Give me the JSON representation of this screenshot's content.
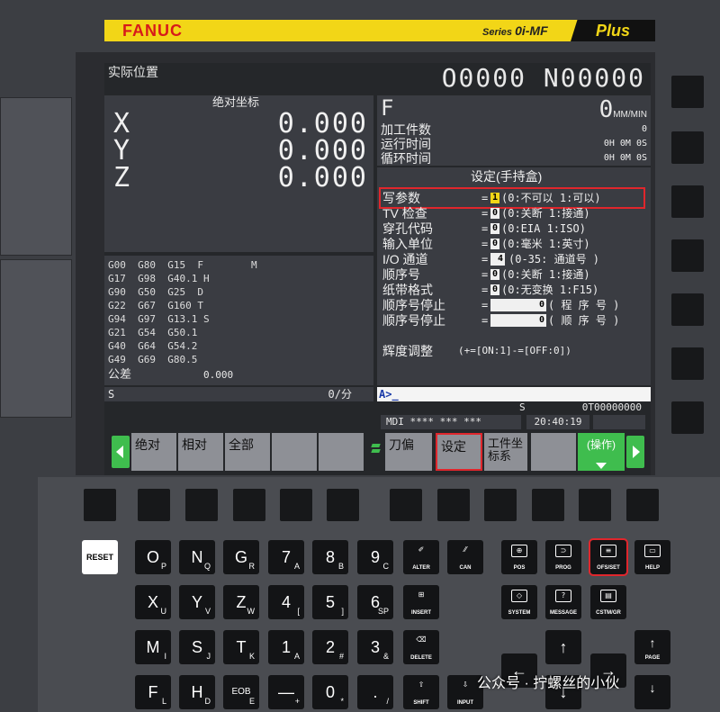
{
  "brand": {
    "name": "FANUC",
    "series": "Series",
    "model": "0i-MF",
    "plus": "Plus"
  },
  "screen": {
    "title": "实际位置",
    "program": "O0000 N00000",
    "abs_title": "绝对坐标",
    "axes": [
      {
        "name": "X",
        "value": "0.000"
      },
      {
        "name": "Y",
        "value": "0.000"
      },
      {
        "name": "Z",
        "value": "0.000"
      }
    ],
    "feed_label": "F",
    "feed_value": "0",
    "feed_unit": "MM/MIN",
    "counters": [
      {
        "label": "加工件数",
        "value": "0"
      },
      {
        "label": "运行时间",
        "value": "0H 0M 0S"
      },
      {
        "label": "循环时间",
        "value": "0H 0M 0S"
      }
    ],
    "gcodes": [
      "G00  G80  G15  F        M",
      "G17  G98  G40.1 H",
      "G90  G50  G25  D",
      "G22  G67  G160 T",
      "G94  G97  G13.1 S",
      "G21  G54  G50.1",
      "G40  G64  G54.2",
      "G49  G69  G80.5"
    ],
    "tolerance_label": "公差",
    "tolerance_value": "0.000",
    "spindle_label": "S",
    "spindle_unit": "0/分",
    "settings_title": "设定(手持盒)",
    "settings": [
      {
        "label": "写参数",
        "value": "1",
        "desc": "(0:不可以    1:可以)"
      },
      {
        "label": "TV  检查",
        "value": "0",
        "desc": "(0:关断 1:接通)"
      },
      {
        "label": "穿孔代码",
        "value": "0",
        "desc": "(0:EIA   1:ISO)"
      },
      {
        "label": "输入单位",
        "value": "0",
        "desc": "(0:毫米    1:英寸)"
      },
      {
        "label": "I/O  通道",
        "value": "4",
        "desc": "(0-35: 通道号    )"
      },
      {
        "label": "顺序号",
        "value": "0",
        "desc": "(0:关断 1:接通)"
      },
      {
        "label": "纸带格式",
        "value": "0",
        "desc": "(0:无变换   1:F15)"
      },
      {
        "label": "顺序号停止",
        "value": "0",
        "desc": "(  程  序  号  )"
      },
      {
        "label": "顺序号停止",
        "value": "0",
        "desc": "(  顺  序  号  )"
      }
    ],
    "brightness_label": "辉度调整",
    "brightness_desc": "(+=[ON:1]-=[OFF:0])",
    "input_prompt": "A>_",
    "status_s": "S",
    "status_t": "0T00000000",
    "mode": "MDI",
    "mode_stars": "**** *** ***",
    "time": "20:40:19",
    "softkeys": [
      "绝对",
      "相对",
      "全部",
      "",
      "",
      "刀偏",
      "设定",
      "工件坐标系",
      "",
      "(操作)"
    ]
  },
  "keypad": {
    "reset": "RESET",
    "rows": [
      [
        {
          "m": "O",
          "s": "P"
        },
        {
          "m": "N",
          "s": "Q"
        },
        {
          "m": "G",
          "s": "R"
        },
        {
          "m": "7",
          "s": "A"
        },
        {
          "m": "8",
          "s": "B"
        },
        {
          "m": "9",
          "s": "C"
        },
        {
          "t": "ALTER"
        },
        {
          "t": "CAN"
        }
      ],
      [
        {
          "m": "X",
          "s": "U"
        },
        {
          "m": "Y",
          "s": "V"
        },
        {
          "m": "Z",
          "s": "W"
        },
        {
          "m": "4",
          "s": "["
        },
        {
          "m": "5",
          "s": "]"
        },
        {
          "m": "6",
          "s": "SP"
        },
        {
          "t": "INSERT"
        }
      ],
      [
        {
          "m": "M",
          "s": "I"
        },
        {
          "m": "S",
          "s": "J"
        },
        {
          "m": "T",
          "s": "K"
        },
        {
          "m": "1",
          "s": "A"
        },
        {
          "m": "2",
          "s": "#"
        },
        {
          "m": "3",
          "s": "&"
        },
        {
          "t": "DELETE"
        }
      ],
      [
        {
          "m": "F",
          "s": "L"
        },
        {
          "m": "H",
          "s": "D"
        },
        {
          "m": "EOB",
          "s": "E"
        },
        {
          "m": "—",
          "s": "+"
        },
        {
          "m": "0",
          "s": "*"
        },
        {
          "m": ".",
          "s": "/"
        },
        {
          "t": "SHIFT"
        },
        {
          "t": "INPUT"
        }
      ]
    ],
    "func_keys": [
      "POS",
      "PROG",
      "OFS/SET",
      "HELP",
      "SYSTEM",
      "MESSAGE",
      "CSTM/GR"
    ],
    "page": "PAGE",
    "watermark": "公众号 · 拧螺丝的小伙"
  }
}
